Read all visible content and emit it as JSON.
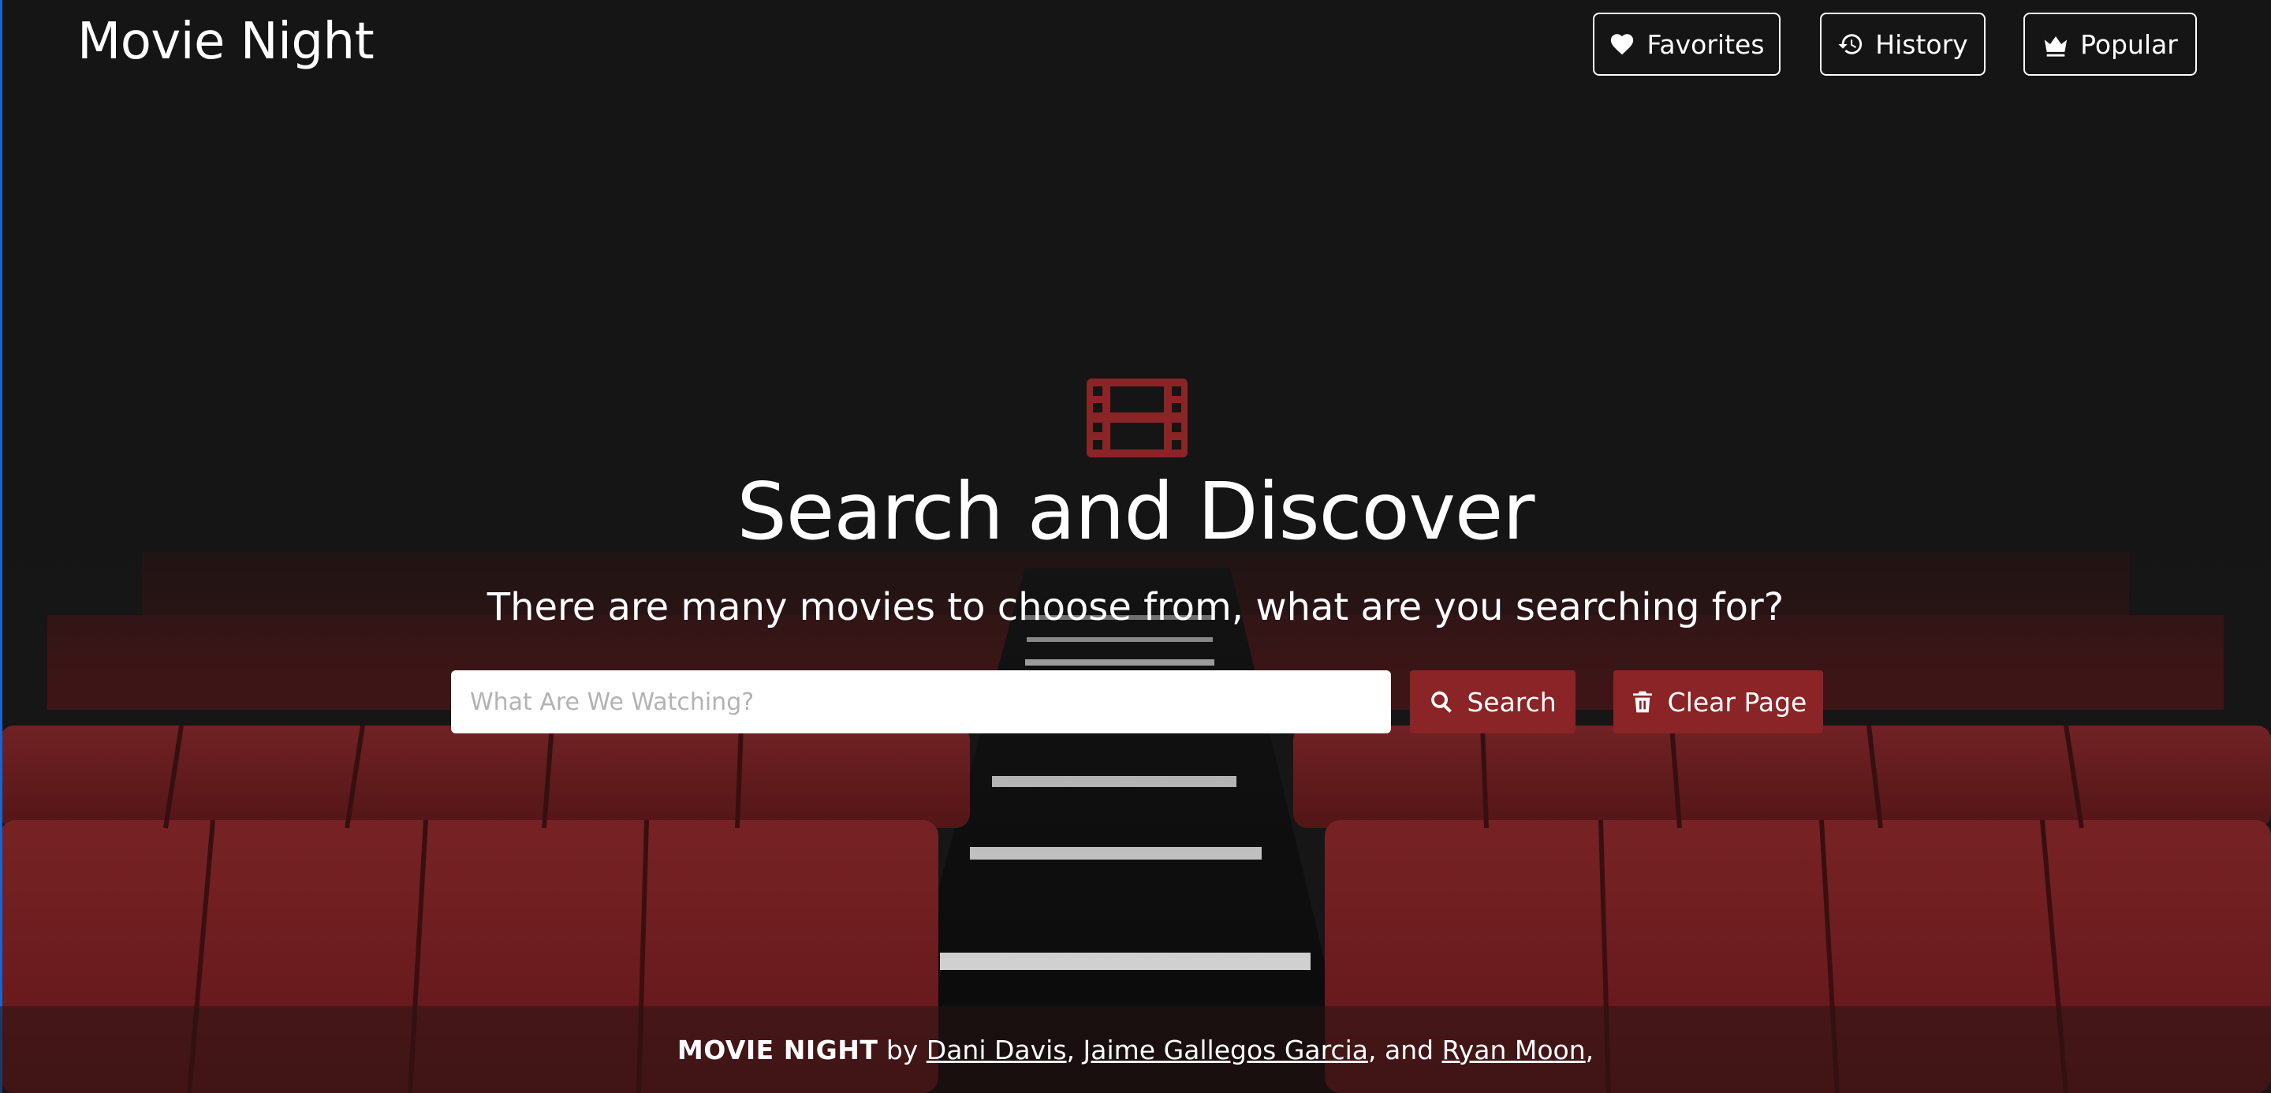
{
  "header": {
    "brand": "Movie Night",
    "nav": {
      "favorites_label": "Favorites",
      "history_label": "History",
      "popular_label": "Popular"
    }
  },
  "hero": {
    "icon": "film-icon",
    "title": "Search and Discover",
    "subtitle": "There are many movies to choose from, what are you searching for?",
    "search": {
      "placeholder": "What Are We Watching?",
      "value": "",
      "search_label": "Search",
      "clear_label": "Clear Page"
    }
  },
  "footer": {
    "app_name": "MOVIE NIGHT",
    "by_text": " by ",
    "authors": [
      "Dani Davis",
      "Jaime Gallegos Garcia",
      "Ryan Moon"
    ],
    "sep1": ", ",
    "sep2": ", and ",
    "trailing": ","
  },
  "colors": {
    "accent": "#8b2426",
    "background": "#141414",
    "seat_red": "#7a1e20"
  }
}
